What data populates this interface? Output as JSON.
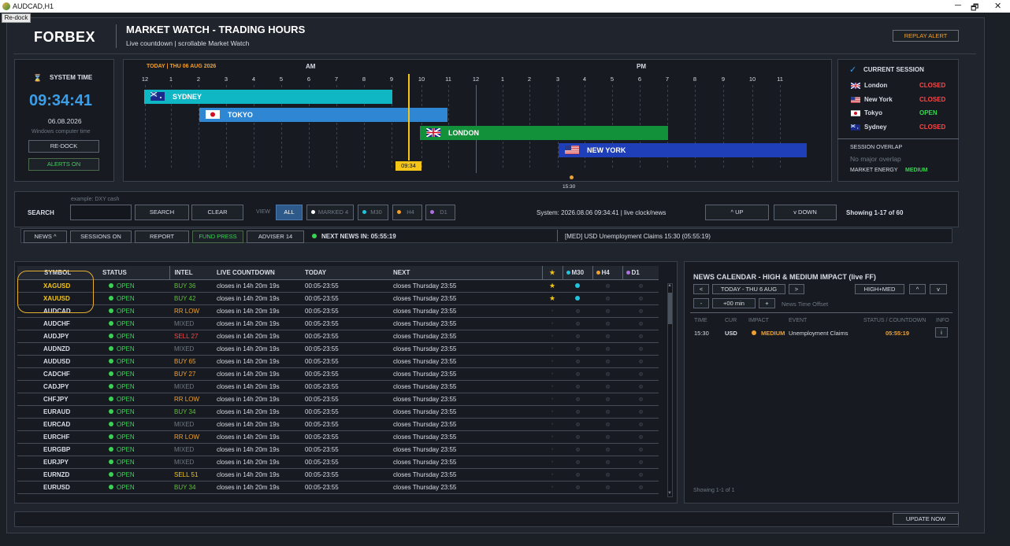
{
  "window": {
    "title": "AUDCAD,H1",
    "redock_label": "Re-dock",
    "controls": [
      "─",
      "🗗",
      "✕"
    ]
  },
  "header": {
    "logo": "FORBEX",
    "title": "MARKET WATCH - TRADING HOURS",
    "subtitle": "Live countdown  |  scrollable Market Watch",
    "replay_label": "REPLAY ALERT"
  },
  "system": {
    "heading": "SYSTEM TIME",
    "time": "09:34:41",
    "date": "06.08.2026",
    "note": "Windows computer time",
    "redock_label": "RE-DOCK",
    "alerts_label": "ALERTS ON"
  },
  "timeline": {
    "today": "TODAY  |  THU 06 AUG 2026",
    "am": "AM",
    "pm": "PM",
    "ticks": [
      "12",
      "1",
      "2",
      "3",
      "4",
      "5",
      "6",
      "7",
      "8",
      "9",
      "10",
      "11",
      "12",
      "1",
      "2",
      "3",
      "4",
      "5",
      "6",
      "7",
      "8",
      "9",
      "10",
      "11"
    ],
    "now_label": "09:34",
    "event_label": "15:30",
    "sessions": [
      {
        "name": "SYDNEY",
        "color": "#0fb6c4",
        "flag": "au"
      },
      {
        "name": "TOKYO",
        "color": "#2f86d2",
        "flag": "jp"
      },
      {
        "name": "LONDON",
        "color": "#13913a",
        "flag": "gb"
      },
      {
        "name": "NEW YORK",
        "color": "#1e3fb8",
        "flag": "us"
      }
    ]
  },
  "current_session": {
    "heading": "CURRENT SESSION",
    "rows": [
      {
        "name": "London",
        "status": "CLOSED",
        "flag": "gb"
      },
      {
        "name": "New York",
        "status": "CLOSED",
        "flag": "us"
      },
      {
        "name": "Tokyo",
        "status": "OPEN",
        "flag": "jp"
      },
      {
        "name": "Sydney",
        "status": "CLOSED",
        "flag": "au"
      }
    ],
    "overlap_heading": "SESSION OVERLAP",
    "overlap_value": "No major overlap",
    "energy_label": "MARKET ENERGY",
    "energy_value": "MEDIUM"
  },
  "toolbar": {
    "search_label": "SEARCH",
    "search_placeholder": "example: DXY cash",
    "search_value": "",
    "search_btn": "SEARCH",
    "clear_btn": "CLEAR",
    "view_label": "VIEW",
    "all_btn": "ALL",
    "marked_btn": "MARKED 4",
    "m30_btn": "M30",
    "h4_btn": "H4",
    "d1_btn": "D1",
    "system_info": "System: 2026.08.06 09:34:41  |  live clock/news",
    "up_btn": "^  UP",
    "down_btn": "v  DOWN",
    "showing": "Showing 1-17 of 60"
  },
  "subbar": {
    "news_btn": "NEWS ^",
    "sessions_btn": "SESSIONS ON",
    "report_btn": "REPORT",
    "fund_btn": "FUND PRESS",
    "adviser_btn": "ADVISER 14",
    "next_news": "NEXT NEWS IN: 05:55:19",
    "ticker": "[MED] USD Unemployment Claims 15:30 (05:55:19)"
  },
  "market_watch": {
    "headers": [
      "SYMBOL",
      "STATUS",
      "INTEL",
      "LIVE COUNTDOWN",
      "TODAY",
      "NEXT",
      "★",
      "M30",
      "H4",
      "D1"
    ],
    "rows": [
      {
        "symbol": "XAGUSD",
        "status": "OPEN",
        "intel": "BUY 36",
        "intel_color": "#5fbf3a",
        "countdown": "closes in 14h 20m 19s",
        "today": "00:05-23:55",
        "next": "closes Thursday 23:55",
        "star": true,
        "m30": true,
        "highlight": true
      },
      {
        "symbol": "XAUUSD",
        "status": "OPEN",
        "intel": "BUY 42",
        "intel_color": "#5fbf3a",
        "countdown": "closes in 14h 20m 19s",
        "today": "00:05-23:55",
        "next": "closes Thursday 23:55",
        "star": true,
        "m30": true,
        "highlight": true
      },
      {
        "symbol": "AUDCAD",
        "status": "OPEN",
        "intel": "RR LOW",
        "intel_color": "#f0a030",
        "countdown": "closes in 14h 20m 19s",
        "today": "00:05-23:55",
        "next": "closes Thursday 23:55"
      },
      {
        "symbol": "AUDCHF",
        "status": "OPEN",
        "intel": "MIXED",
        "intel_color": "#6f7782",
        "countdown": "closes in 14h 20m 19s",
        "today": "00:05-23:55",
        "next": "closes Thursday 23:55"
      },
      {
        "symbol": "AUDJPY",
        "status": "OPEN",
        "intel": "SELL 27",
        "intel_color": "#ff4545",
        "countdown": "closes in 14h 20m 19s",
        "today": "00:05-23:55",
        "next": "closes Thursday 23:55"
      },
      {
        "symbol": "AUDNZD",
        "status": "OPEN",
        "intel": "MIXED",
        "intel_color": "#6f7782",
        "countdown": "closes in 14h 20m 19s",
        "today": "00:05-23:55",
        "next": "closes Thursday 23:55"
      },
      {
        "symbol": "AUDUSD",
        "status": "OPEN",
        "intel": "BUY 65",
        "intel_color": "#f0a030",
        "countdown": "closes in 14h 20m 19s",
        "today": "00:05-23:55",
        "next": "closes Thursday 23:55"
      },
      {
        "symbol": "CADCHF",
        "status": "OPEN",
        "intel": "BUY 27",
        "intel_color": "#f0a030",
        "countdown": "closes in 14h 20m 19s",
        "today": "00:05-23:55",
        "next": "closes Thursday 23:55"
      },
      {
        "symbol": "CADJPY",
        "status": "OPEN",
        "intel": "MIXED",
        "intel_color": "#6f7782",
        "countdown": "closes in 14h 20m 19s",
        "today": "00:05-23:55",
        "next": "closes Thursday 23:55"
      },
      {
        "symbol": "CHFJPY",
        "status": "OPEN",
        "intel": "RR LOW",
        "intel_color": "#f0a030",
        "countdown": "closes in 14h 20m 19s",
        "today": "00:05-23:55",
        "next": "closes Thursday 23:55"
      },
      {
        "symbol": "EURAUD",
        "status": "OPEN",
        "intel": "BUY 34",
        "intel_color": "#5fbf3a",
        "countdown": "closes in 14h 20m 19s",
        "today": "00:05-23:55",
        "next": "closes Thursday 23:55"
      },
      {
        "symbol": "EURCAD",
        "status": "OPEN",
        "intel": "MIXED",
        "intel_color": "#6f7782",
        "countdown": "closes in 14h 20m 19s",
        "today": "00:05-23:55",
        "next": "closes Thursday 23:55"
      },
      {
        "symbol": "EURCHF",
        "status": "OPEN",
        "intel": "RR LOW",
        "intel_color": "#f0a030",
        "countdown": "closes in 14h 20m 19s",
        "today": "00:05-23:55",
        "next": "closes Thursday 23:55"
      },
      {
        "symbol": "EURGBP",
        "status": "OPEN",
        "intel": "MIXED",
        "intel_color": "#6f7782",
        "countdown": "closes in 14h 20m 19s",
        "today": "00:05-23:55",
        "next": "closes Thursday 23:55"
      },
      {
        "symbol": "EURJPY",
        "status": "OPEN",
        "intel": "MIXED",
        "intel_color": "#6f7782",
        "countdown": "closes in 14h 20m 19s",
        "today": "00:05-23:55",
        "next": "closes Thursday 23:55"
      },
      {
        "symbol": "EURNZD",
        "status": "OPEN",
        "intel": "SELL 51",
        "intel_color": "#f5c518",
        "countdown": "closes in 14h 20m 19s",
        "today": "00:05-23:55",
        "next": "closes Thursday 23:55"
      },
      {
        "symbol": "EURUSD",
        "status": "OPEN",
        "intel": "BUY 34",
        "intel_color": "#5fbf3a",
        "countdown": "closes in 14h 20m 19s",
        "today": "00:05-23:55",
        "next": "closes Thursday 23:55"
      }
    ]
  },
  "news": {
    "title": "NEWS CALENDAR - HIGH & MEDIUM IMPACT (live FF)",
    "prev": "<",
    "date": "TODAY - THU 6 AUG",
    "next": ">",
    "filter": "HIGH+MED",
    "up": "^",
    "down": "v",
    "minus": "-",
    "offset": "+00 min",
    "plus": "+",
    "offset_label": "News Time Offset",
    "headers": [
      "TIME",
      "CUR",
      "IMPACT",
      "EVENT",
      "STATUS / COUNTDOWN",
      "INFO"
    ],
    "rows": [
      {
        "time": "15:30",
        "cur": "USD",
        "impact": "MEDIUM",
        "event": "Unemployment Claims",
        "countdown": "05:55:19",
        "info": "i"
      }
    ],
    "footer": "Showing 1-1 of 1"
  },
  "footer": {
    "update_label": "UPDATE NOW"
  }
}
